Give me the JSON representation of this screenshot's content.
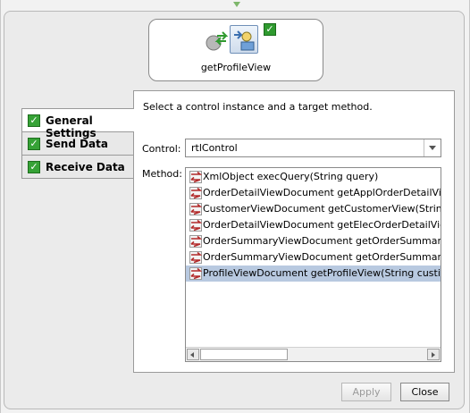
{
  "node": {
    "label": "getProfileView"
  },
  "tabs": [
    {
      "label": "General Settings",
      "active": true
    },
    {
      "label": "Send Data",
      "active": false
    },
    {
      "label": "Receive Data",
      "active": false
    }
  ],
  "panel": {
    "instruction": "Select a control instance and a target method.",
    "control_label": "Control:",
    "control_value": "rtlControl",
    "method_label": "Method:",
    "methods": [
      {
        "label": "XmlObject execQuery(String query)"
      },
      {
        "label": "OrderDetailViewDocument getApplOrderDetailView(String"
      },
      {
        "label": "CustomerViewDocument getCustomerView(String custid"
      },
      {
        "label": "OrderDetailViewDocument getElecOrderDetailView(String"
      },
      {
        "label": "OrderSummaryViewDocument getOrderSummaryView(Tr"
      },
      {
        "label": "OrderSummaryViewDocument getOrderSummaryViewW"
      },
      {
        "label": "ProfileViewDocument getProfileView(String custid)",
        "selected": true
      }
    ],
    "selected_method": "ProfileViewDocument getProfileView(String custid)"
  },
  "buttons": {
    "apply": "Apply",
    "close": "Close"
  },
  "colors": {
    "selection": "#b8c9e0",
    "check_green": "#36a236",
    "connector": "#7db66b"
  },
  "icons": [
    "check-icon",
    "method-icon",
    "control-icon",
    "dropdown-arrow-icon",
    "scroll-left-icon",
    "scroll-right-icon"
  ]
}
